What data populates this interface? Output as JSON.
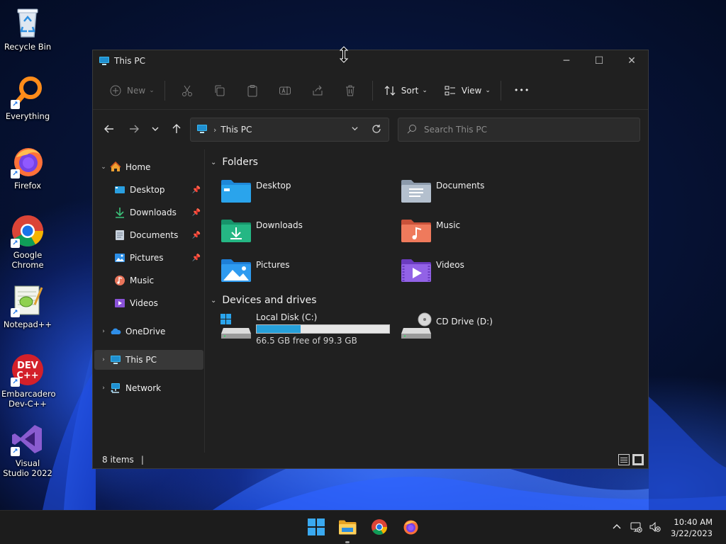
{
  "desktop": {
    "icons": [
      {
        "label": "Recycle Bin",
        "icon": "recycle-bin-icon"
      },
      {
        "label": "Everything",
        "icon": "everything-icon"
      },
      {
        "label": "Firefox",
        "icon": "firefox-icon"
      },
      {
        "label": "Google Chrome",
        "icon": "chrome-icon"
      },
      {
        "label": "Notepad++",
        "icon": "notepad-plus-plus-icon"
      },
      {
        "label": "Embarcadero Dev-C++",
        "icon": "dev-cpp-icon"
      },
      {
        "label": "Visual Studio 2022",
        "icon": "visual-studio-icon"
      }
    ]
  },
  "window": {
    "title": "This PC",
    "controls": {
      "minimize": "─",
      "maximize": "☐",
      "close": "✕"
    }
  },
  "command_bar": {
    "new_label": "New",
    "sort_label": "Sort",
    "view_label": "View",
    "more_label": "•••"
  },
  "address": {
    "location": "This PC",
    "search_placeholder": "Search This PC"
  },
  "nav_pane": {
    "home": "Home",
    "quick_access": [
      {
        "label": "Desktop",
        "pinned": true
      },
      {
        "label": "Downloads",
        "pinned": true
      },
      {
        "label": "Documents",
        "pinned": true
      },
      {
        "label": "Pictures",
        "pinned": true
      },
      {
        "label": "Music",
        "pinned": false
      },
      {
        "label": "Videos",
        "pinned": false
      }
    ],
    "onedrive": "OneDrive",
    "this_pc": "This PC",
    "network": "Network"
  },
  "content": {
    "folders_header": "Folders",
    "folders": [
      "Desktop",
      "Documents",
      "Downloads",
      "Music",
      "Pictures",
      "Videos"
    ],
    "drives_header": "Devices and drives",
    "drives": [
      {
        "name": "Local Disk (C:)",
        "free": "66.5 GB free of 99.3 GB",
        "used_fraction": 0.33
      },
      {
        "name": "CD Drive (D:)"
      }
    ]
  },
  "status_bar": {
    "item_count": "8 items",
    "caret": "|"
  },
  "taskbar": {
    "apps": [
      "start-icon",
      "file-explorer-icon",
      "chrome-icon",
      "firefox-icon"
    ],
    "time": "10:40 AM",
    "date": "3/22/2023"
  },
  "colors": {
    "accent": "#26a0da",
    "window_bg": "#202020",
    "taskbar_bg": "#1c1c1c"
  }
}
